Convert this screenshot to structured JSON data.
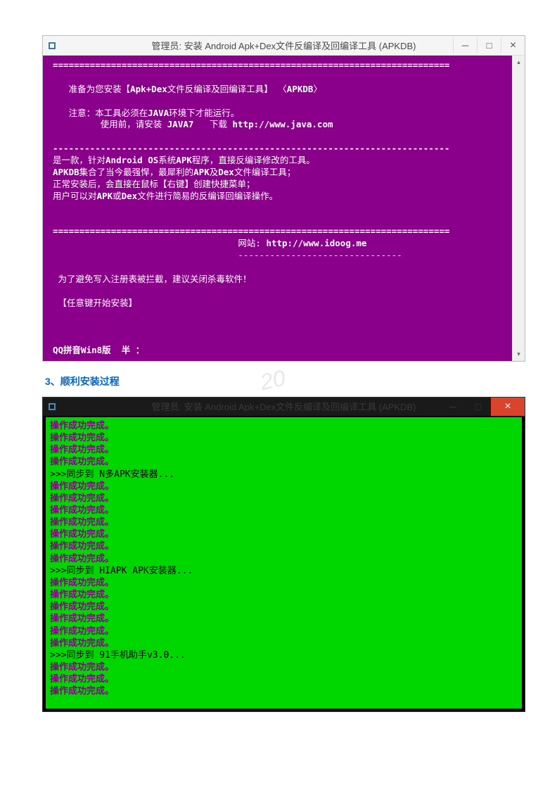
{
  "win1": {
    "title": "管理员: 安装 Android Apk+Dex文件反编译及回编译工具 (APKDB)",
    "minimize": "─",
    "maximize": "□",
    "close": "×",
    "scroll_up": "▴",
    "scroll_down": "▾",
    "sep1": "===========================================================================",
    "line1_a": "   准备为您安装【",
    "line1_b": "Apk+Dex",
    "line1_c": "文件反编译及回编译工具】 〈",
    "line1_d": "APKDB",
    "line1_e": "〉",
    "line2_a": "   注意：本工具必须在",
    "line2_b": "JAVA",
    "line2_c": "环境下才能运行。",
    "line3_a": "         使用前，请安装 ",
    "line3_b": "JAVA7",
    "line3_c": "   下载 ",
    "line3_d": "http://www.java.com",
    "sep2": "---------------------------------------------------------------------------",
    "line4_a": "是一款，针对",
    "line4_b": "Android OS",
    "line4_c": "系统",
    "line4_d": "APK",
    "line4_e": "程序，直接反编译修改的工具。",
    "line5_a": "APKDB",
    "line5_b": "集合了当今最强悍，最犀利的",
    "line5_c": "APK",
    "line5_d": "及",
    "line5_e": "Dex",
    "line5_f": "文件编译工具；",
    "line6": "正常安装后，会直接在鼠标【右键】创建快捷菜单；",
    "line7_a": "用户可以对",
    "line7_b": "APK",
    "line7_c": "或",
    "line7_d": "Dex",
    "line7_e": "文件进行简易的反编译回编译操作。",
    "sep3": "===========================================================================",
    "site_a": "                                   网站: ",
    "site_b": "http://www.idoog.me",
    "siteline": "                                   -------------------------------",
    "warn": " 为了避免写入注册表被拦截，建议关闭杀毒软件！",
    "press": " 【任意键开始安装】",
    "ime": "QQ拼音Win8版  半 ："
  },
  "heading": "3、顺利安装过程",
  "watermark": "20",
  "win2": {
    "title": "管理员: 安装 Android Apk+Dex文件反编译及回编译工具 (APKDB)",
    "minimize": "─",
    "maximize": "□",
    "close": "×",
    "ok": "操作成功完成。",
    "s1": ">>>同步到 N多APK安装器...",
    "s2": ">>>同步到 HIAPK APK安装器...",
    "s3": ">>>同步到 91手机助手v3.0...",
    "top_seq": [
      "ok",
      "ok",
      "ok",
      "ok"
    ],
    "mid1_seq": [
      "ok",
      "ok",
      "ok",
      "ok",
      "ok",
      "ok",
      "ok"
    ],
    "mid2_seq": [
      "ok",
      "ok",
      "ok",
      "ok",
      "ok",
      "ok"
    ],
    "bot_seq": [
      "ok",
      "ok",
      "ok"
    ]
  }
}
